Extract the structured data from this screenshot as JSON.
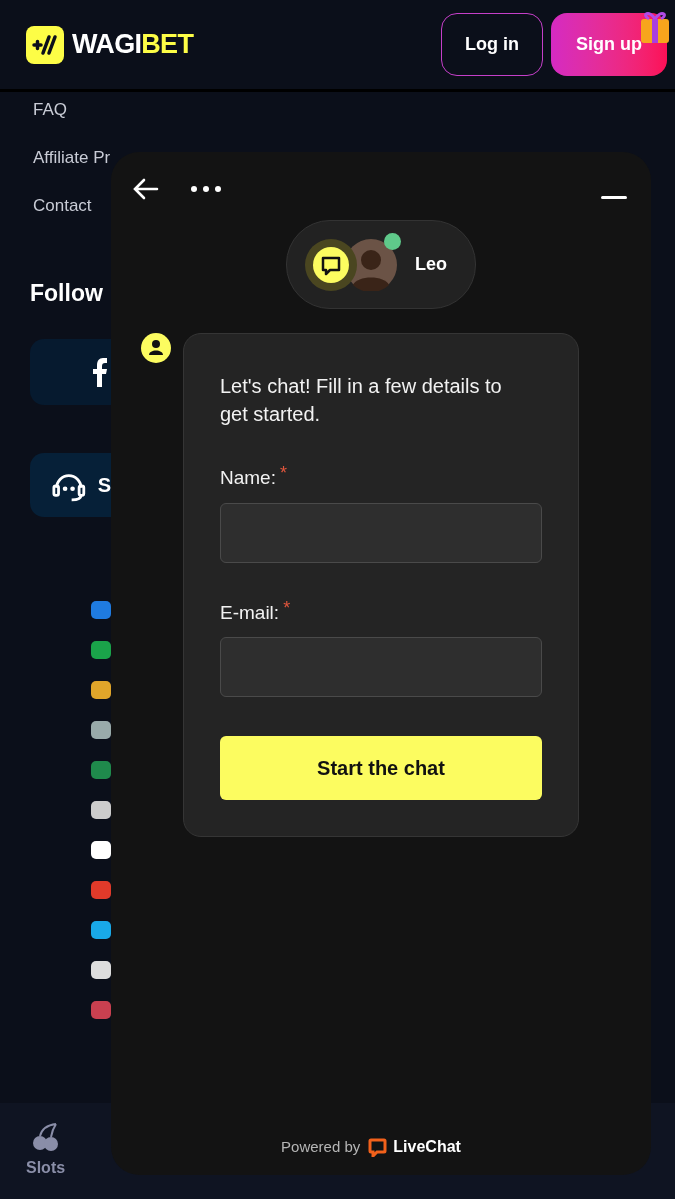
{
  "header": {
    "logo": {
      "part_1": "WAGI",
      "part_2": "BET"
    },
    "login": "Log in",
    "signup": "Sign up"
  },
  "background_page": {
    "links": [
      "FAQ",
      "Affiliate Pr",
      "Contact"
    ],
    "follow_heading": "Follow",
    "support_button": "S",
    "bottom_nav": [
      {
        "label": "Slots",
        "selected": false
      }
    ]
  },
  "chat": {
    "agent": {
      "name": "Leo",
      "online": true
    },
    "message": "Let's chat! Fill in a few details to get started.",
    "fields": [
      {
        "label": "Name:",
        "required": true,
        "marker": "*"
      },
      {
        "label": "E-mail:",
        "required": true,
        "marker": "*"
      }
    ],
    "submit": "Start the chat",
    "footer": {
      "prefix": "Powered by",
      "brand": "LiveChat"
    }
  }
}
